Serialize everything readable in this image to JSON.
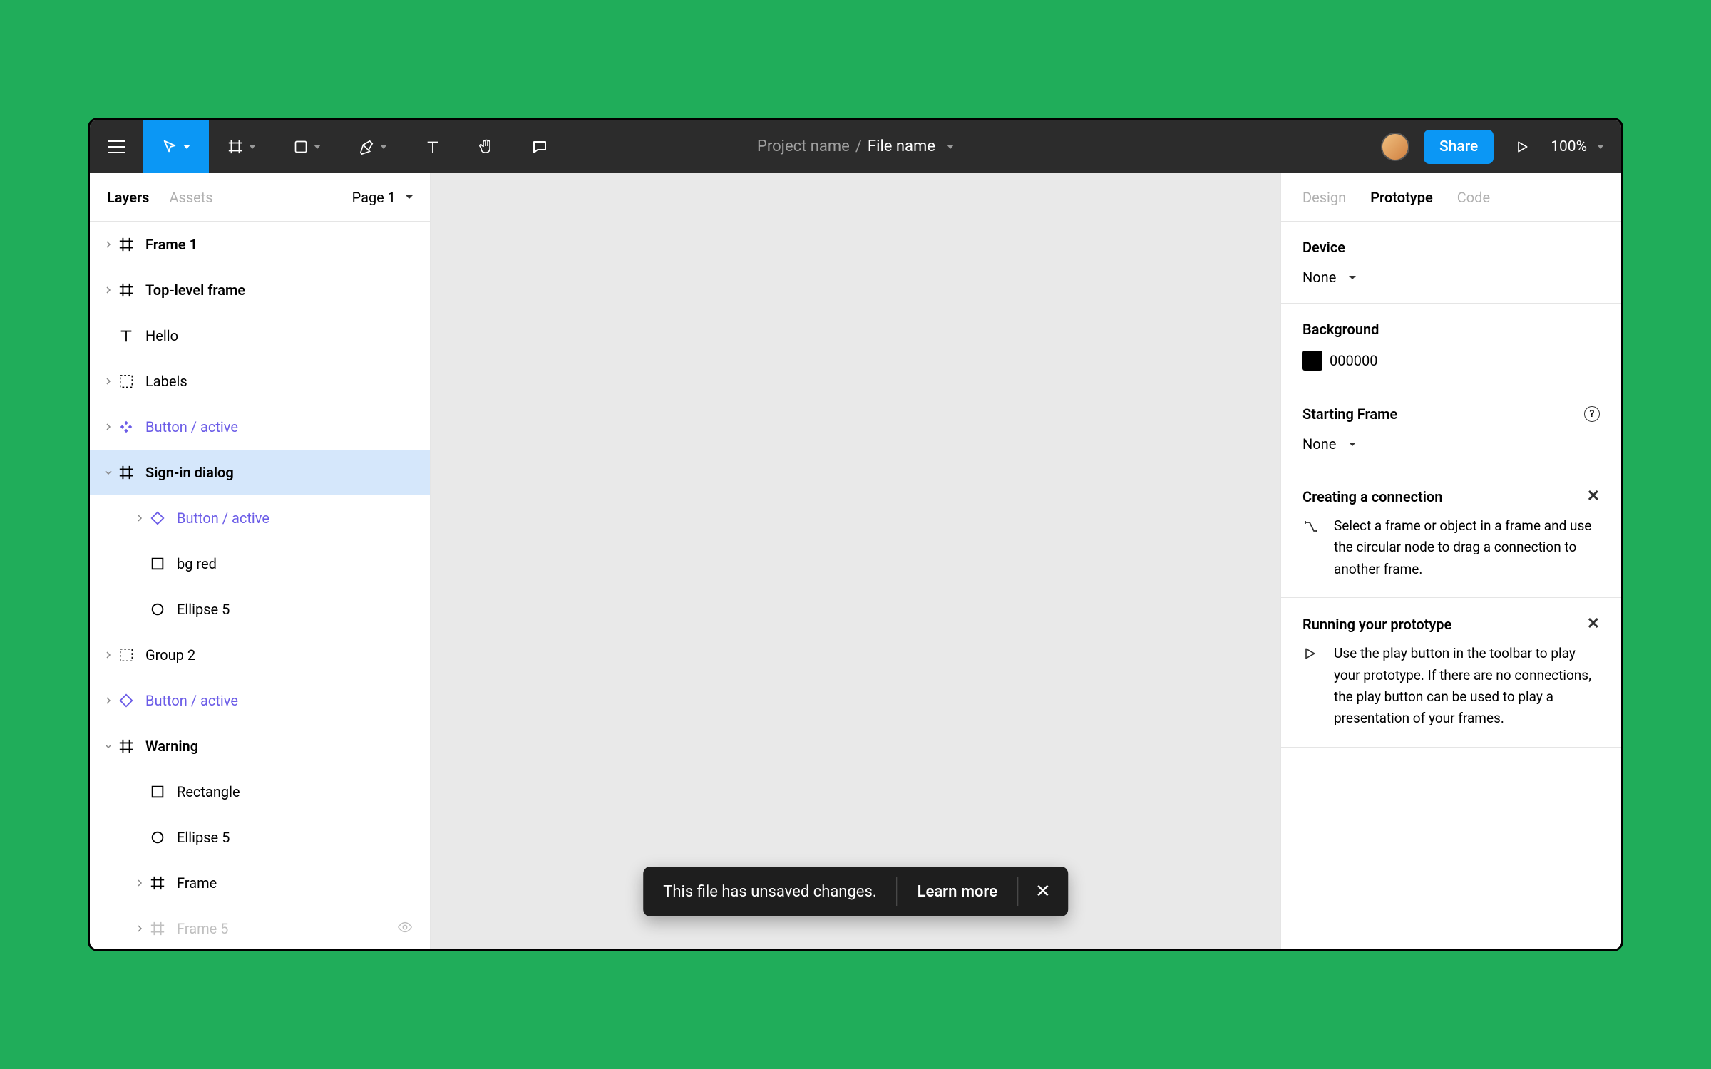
{
  "header": {
    "project_label": "Project name",
    "separator": "/",
    "file_name": "File name",
    "share_label": "Share",
    "zoom": "100%"
  },
  "left_panel": {
    "tabs": {
      "layers": "Layers",
      "assets": "Assets"
    },
    "page_selector": "Page 1",
    "layers": [
      {
        "name": "Frame 1",
        "icon": "frame",
        "depth": 0,
        "bold": true,
        "chev": "right"
      },
      {
        "name": "Top-level frame",
        "icon": "frame",
        "depth": 0,
        "bold": true,
        "chev": "right"
      },
      {
        "name": "Hello",
        "icon": "text",
        "depth": 0
      },
      {
        "name": "Labels",
        "icon": "group",
        "depth": 0,
        "chev": "right"
      },
      {
        "name": "Button / active",
        "icon": "component",
        "depth": 0,
        "purple": true,
        "chev": "right"
      },
      {
        "name": "Sign-in dialog",
        "icon": "frame",
        "depth": 0,
        "bold": true,
        "selected": true,
        "chev": "down"
      },
      {
        "name": "Button / active",
        "icon": "instance",
        "depth": 1,
        "purple": true,
        "chev": "right"
      },
      {
        "name": "bg red",
        "icon": "rect",
        "depth": 1
      },
      {
        "name": "Ellipse 5",
        "icon": "ellipse",
        "depth": 1
      },
      {
        "name": "Group 2",
        "icon": "group",
        "depth": 0,
        "chev": "right"
      },
      {
        "name": "Button / active",
        "icon": "instance",
        "depth": 0,
        "purple": true,
        "chev": "right"
      },
      {
        "name": "Warning",
        "icon": "frame",
        "depth": 0,
        "bold": true,
        "chev": "down"
      },
      {
        "name": "Rectangle",
        "icon": "rect",
        "depth": 1
      },
      {
        "name": "Ellipse 5",
        "icon": "ellipse",
        "depth": 1
      },
      {
        "name": "Frame",
        "icon": "frame",
        "depth": 1,
        "chev": "right"
      },
      {
        "name": "Frame 5",
        "icon": "frame",
        "depth": 1,
        "dim": true,
        "chev": "right",
        "eye": true
      }
    ]
  },
  "toast": {
    "message": "This file has unsaved changes.",
    "action": "Learn more"
  },
  "right_panel": {
    "tabs": {
      "design": "Design",
      "prototype": "Prototype",
      "code": "Code"
    },
    "device": {
      "title": "Device",
      "value": "None"
    },
    "background": {
      "title": "Background",
      "hex": "000000"
    },
    "starting_frame": {
      "title": "Starting Frame",
      "value": "None"
    },
    "help1": {
      "title": "Creating a connection",
      "body": "Select a frame or object in a frame and use the circular node to drag a connection to another frame."
    },
    "help2": {
      "title": "Running your prototype",
      "body": "Use the play button in the toolbar to play your prototype. If there are no connections, the play button can be used to play a presentation of your frames."
    }
  }
}
